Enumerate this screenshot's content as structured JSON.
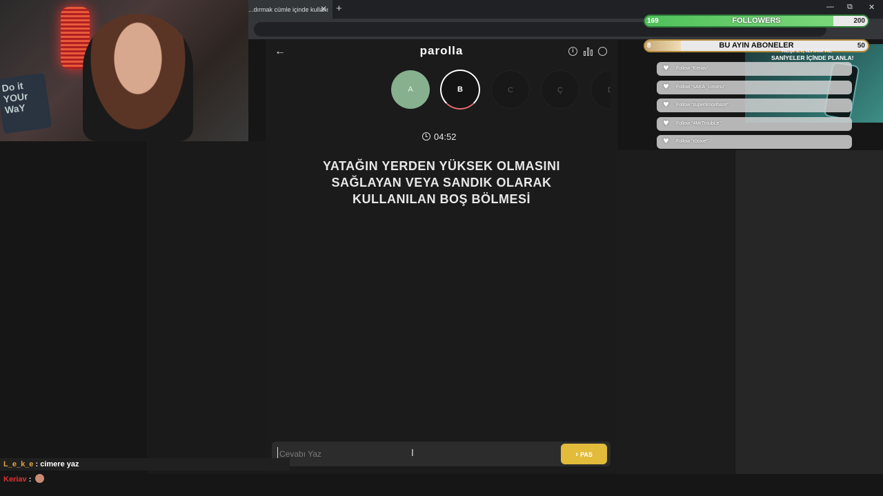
{
  "browser": {
    "tab_title": "...dırmak cümle içinde kullanı",
    "tab_close": "✕",
    "new_tab": "+",
    "window_min": "—",
    "window_max": "⧉",
    "window_close": "✕"
  },
  "webcam": {
    "pillow_text": "Do it YOUr WaY"
  },
  "app": {
    "title": "parolla",
    "back_icon": "←",
    "info_icon": "i"
  },
  "letters": [
    "A",
    "B",
    "C",
    "Ç",
    "D"
  ],
  "timer": "04:52",
  "question": "YATAĞIN YERDEN YÜKSEK OLMASINI SAĞLAYAN VEYA SANDIK OLARAK KULLANILAN BOŞ BÖLMESİ",
  "answer": {
    "placeholder": "Cevabı Yaz",
    "value": ""
  },
  "pass_button": {
    "icon": "›",
    "label": "PAS"
  },
  "overlay": {
    "followers": {
      "current": "169",
      "title": "FOLLOWERS",
      "goal": "200",
      "progress": 0.845
    },
    "subs": {
      "current": "8",
      "title": "BU AYIN ABONELER",
      "goal": "50",
      "progress": 0.16
    },
    "promo": {
      "line1": "KEŞFET, İLHAM AL",
      "line2": "SANİYELER İÇİNDE PLANLA!"
    },
    "alerts": [
      "Follow \"Keriav\"",
      "Follow \"sAKA_Limonu\"",
      "Follow \"superlimonhaze\"",
      "Follow \"4MrTroubLe\"",
      "Follow \"r0oxie\""
    ]
  },
  "chat": [
    {
      "user": "L_e_k_e",
      "message": "cimere yaz"
    },
    {
      "user": "Keriav",
      "message": ""
    }
  ],
  "colors": {
    "accent_green": "#86b08e",
    "pass_yellow": "#e2bb3a",
    "followers_green": "#4fc15a"
  }
}
